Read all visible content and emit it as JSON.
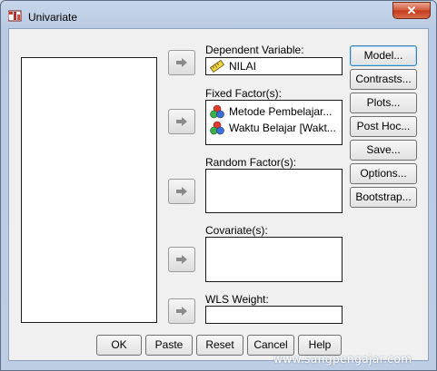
{
  "window": {
    "title": "Univariate",
    "close_glyph": "✕"
  },
  "labels": {
    "dependent": "Dependent Variable:",
    "fixed": "Fixed Factor(s):",
    "random": "Random Factor(s):",
    "covariate": "Covariate(s):",
    "wls": "WLS Weight:"
  },
  "dependent_variable": {
    "name": "NILAI",
    "icon": "ruler-icon"
  },
  "fixed_factors": [
    {
      "name": "Metode Pembelajar...",
      "icon": "nominal-icon"
    },
    {
      "name": "Waktu Belajar  [Wakt...",
      "icon": "nominal-icon"
    }
  ],
  "side_buttons": [
    "Model...",
    "Contrasts...",
    "Plots...",
    "Post Hoc...",
    "Save...",
    "Options...",
    "Bootstrap..."
  ],
  "bottom_buttons": [
    "OK",
    "Paste",
    "Reset",
    "Cancel",
    "Help"
  ],
  "watermark": "www.sangpengajar.com"
}
